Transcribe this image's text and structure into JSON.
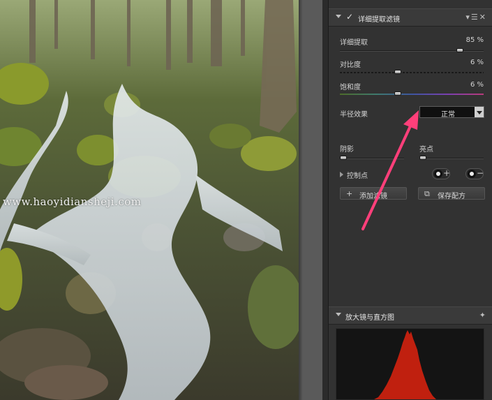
{
  "photo": {
    "description_icon": "image-photo",
    "watermark": "www.haoyidiansheji.com"
  },
  "detail_filter": {
    "title": "详细提取滤镜",
    "enabled": true,
    "sliders": [
      {
        "label": "详细提取",
        "value": "85 %",
        "level": 0.85,
        "track": "solid"
      },
      {
        "label": "对比度",
        "value": "6 %",
        "level": 0.4,
        "track": "dashed"
      },
      {
        "label": "饱和度",
        "value": "6 %",
        "level": 0.4,
        "track": "sat"
      }
    ],
    "radius": {
      "label": "半径效果",
      "value": "正常"
    },
    "shadows": {
      "label": "阴影",
      "level": 0.0
    },
    "highlights": {
      "label": "亮点",
      "level": 0.0
    },
    "control_points": {
      "label": "控制点"
    },
    "add_filter_label": "添加滤镜",
    "save_preset_label": "保存配方"
  },
  "loupe": {
    "title": "放大镜与直方图"
  },
  "colors": {
    "panel_bg": "#323232",
    "histogram": "#c0200f",
    "annotation_arrow": "#ff3f7a"
  }
}
